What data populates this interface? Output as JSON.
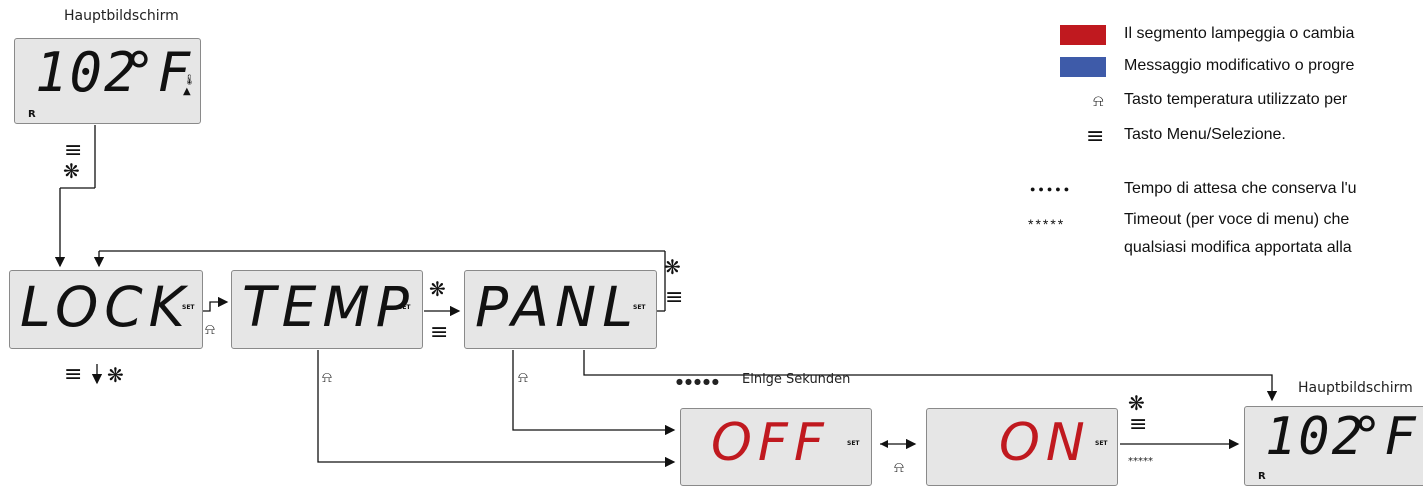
{
  "main_screen_label": "Hauptbildschirm",
  "main_display": {
    "temp": "102",
    "unit": "°F",
    "r_mark": "R"
  },
  "states": [
    {
      "text": "LOCK",
      "set": "SET"
    },
    {
      "text": "TEMP",
      "set": "SET"
    },
    {
      "text": "PANL",
      "set": "SET"
    }
  ],
  "options": [
    {
      "text": "OFF",
      "set": "SET"
    },
    {
      "text": "ON",
      "set": "SET"
    }
  ],
  "wait_label": "Einige Sekunden",
  "wait_dots": "●●●●●",
  "timeout_stars": "*****",
  "legend": {
    "red_text": "Il segmento lampeggia o cambia",
    "blue_text": "Messaggio modificativo o progre",
    "temp_key_text": "Tasto temperatura utilizzato per",
    "menu_key_text": "Tasto Menu/Selezione.",
    "dots_symbol": "●●●●●",
    "dots_text": "Tempo di attesa che conserva l'u",
    "stars_symbol": "*****",
    "stars_text_1": "Timeout (per voce di menu) che",
    "stars_text_2": "qualsiasi modifica apportata alla"
  },
  "colors": {
    "red": "#c0191f",
    "blue": "#3e5ba9",
    "panel": "#e6e6e6"
  }
}
